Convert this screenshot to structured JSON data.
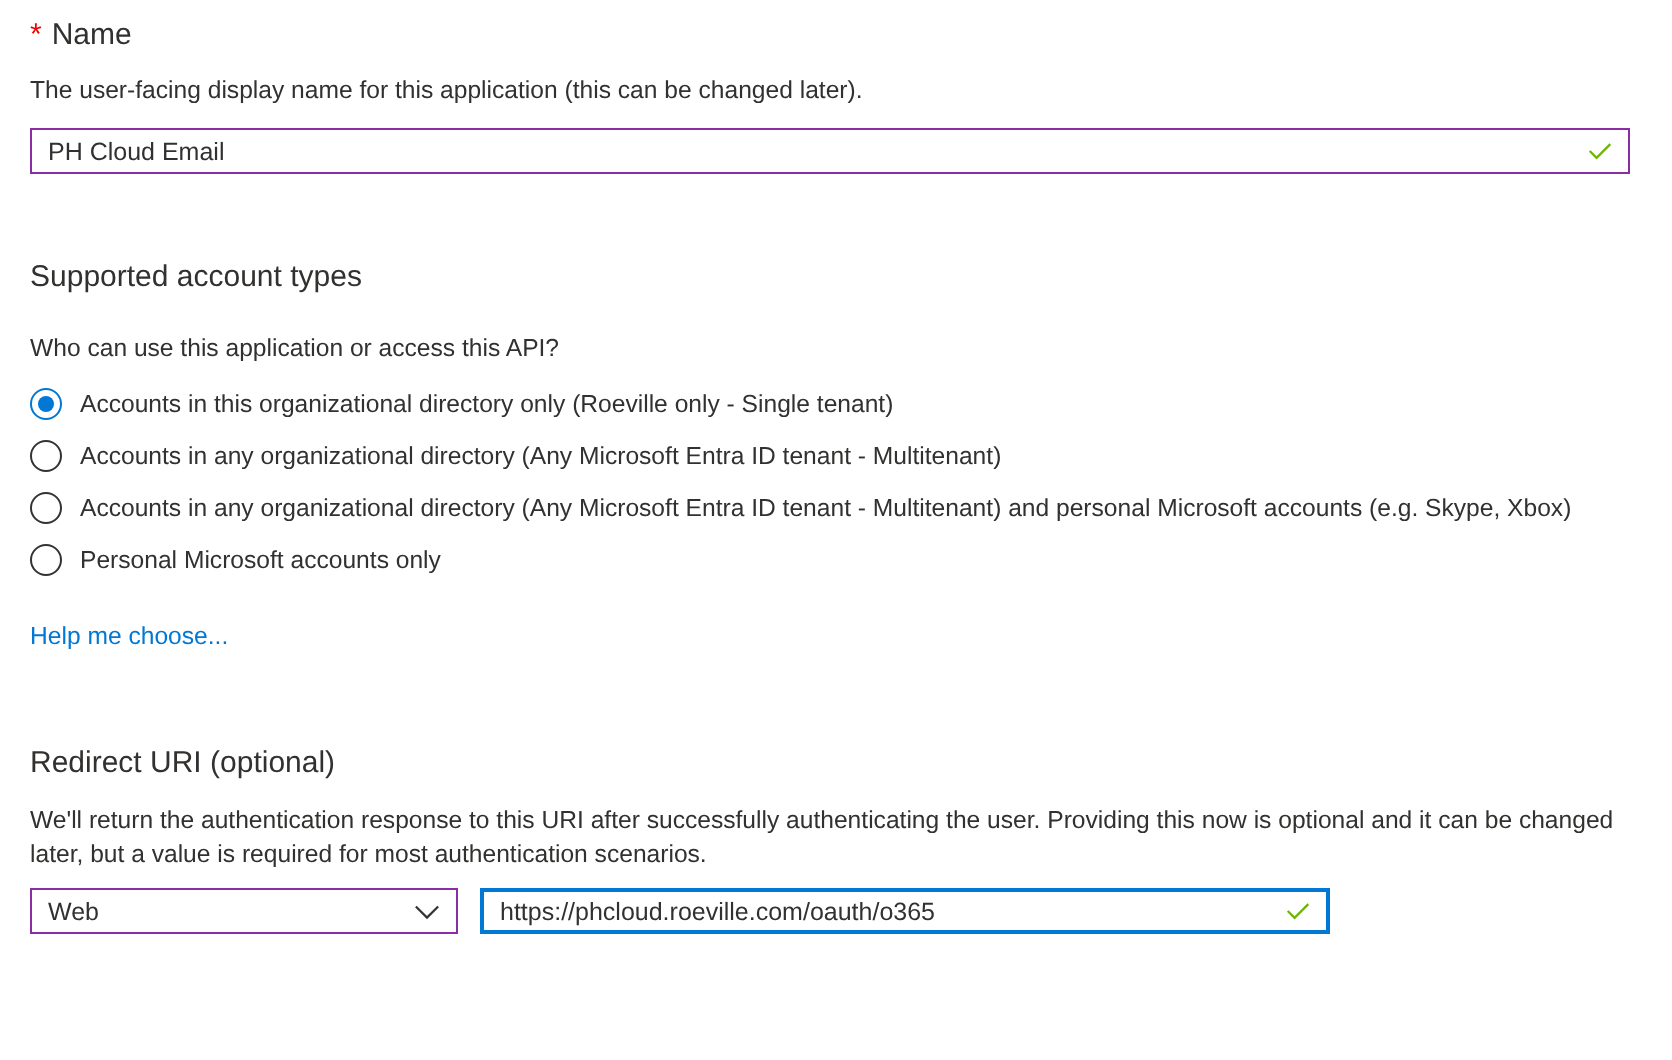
{
  "name_section": {
    "required_mark": "*",
    "heading": "Name",
    "description": "The user-facing display name for this application (this can be changed later).",
    "field": {
      "value": "PH Cloud Email",
      "valid": true,
      "focused": false
    }
  },
  "account_types": {
    "heading": "Supported account types",
    "question": "Who can use this application or access this API?",
    "options": [
      {
        "label": "Accounts in this organizational directory only (Roeville only - Single tenant)",
        "selected": true
      },
      {
        "label": "Accounts in any organizational directory (Any Microsoft Entra ID tenant - Multitenant)",
        "selected": false
      },
      {
        "label": "Accounts in any organizational directory (Any Microsoft Entra ID tenant - Multitenant) and personal Microsoft accounts (e.g. Skype, Xbox)",
        "selected": false
      },
      {
        "label": "Personal Microsoft accounts only",
        "selected": false
      }
    ],
    "help_link": "Help me choose..."
  },
  "redirect": {
    "heading": "Redirect URI (optional)",
    "description": "We'll return the authentication response to this URI after successfully authenticating the user. Providing this now is optional and it can be changed later, but a value is required for most authentication scenarios.",
    "platform": {
      "value": "Web"
    },
    "uri": {
      "value": "https://phcloud.roeville.com/oauth/o365",
      "valid": true,
      "focused": true
    }
  }
}
